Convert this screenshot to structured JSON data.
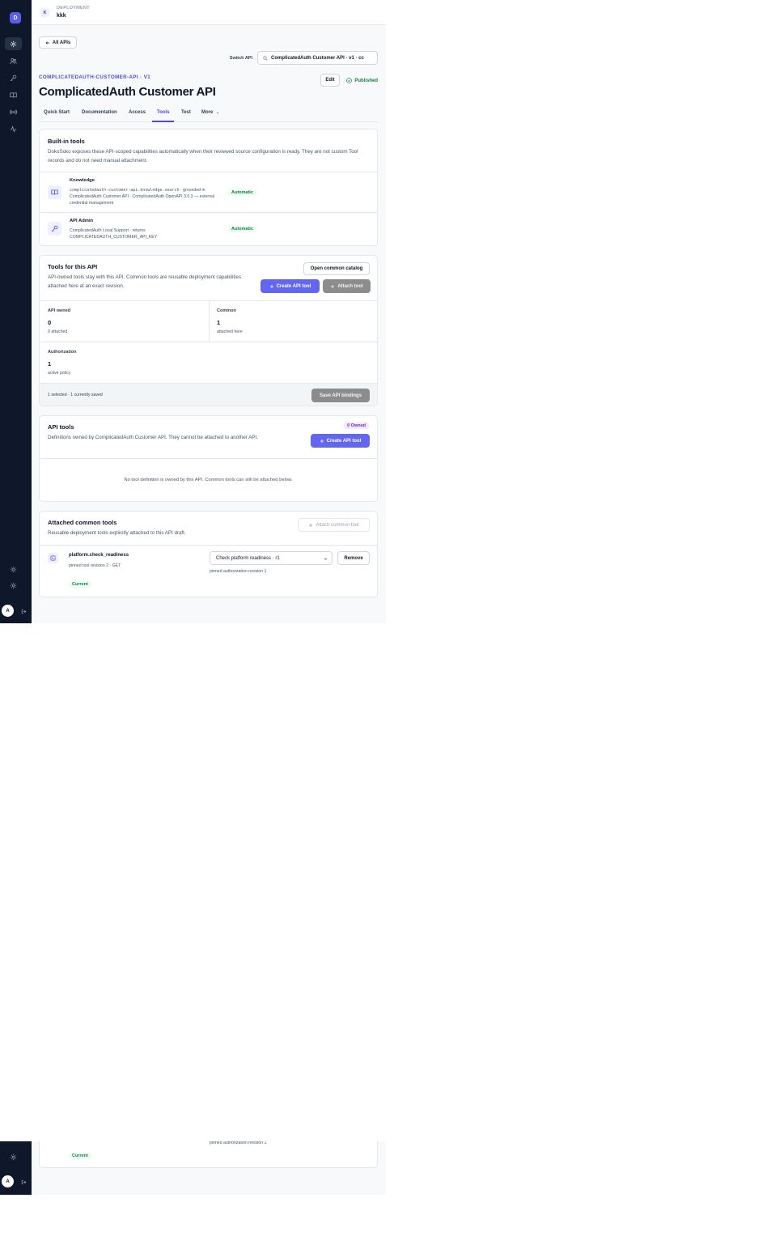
{
  "sidebar": {
    "brand": "D",
    "avatar": "A",
    "nav": [
      "api-icon",
      "users-icon",
      "key-icon",
      "book-icon",
      "broadcast-icon",
      "activity-icon"
    ],
    "bottom": [
      "sun-icon",
      "gear-icon"
    ]
  },
  "topbar": {
    "badge": "K",
    "label": "DEPLOYMENT",
    "name": "kkk"
  },
  "header": {
    "back": "All APIs",
    "switch_label": "Switch API",
    "switch_value": "ComplicatedAuth Customer API · v1 · cc",
    "slug": "COMPLICATEDAUTH-CUSTOMER-API · V1",
    "title": "ComplicatedAuth Customer API",
    "edit": "Edit",
    "status": "Published"
  },
  "tabs": [
    "Quick Start",
    "Documentation",
    "Access",
    "Tools",
    "Test",
    "More"
  ],
  "active_tab": "Tools",
  "builtin": {
    "title": "Built-in tools",
    "desc": "DokoSoko exposes these API-scoped capabilities automatically when their reviewed source configuration is ready. They are not custom Tool records and do not need manual attachment.",
    "items": [
      {
        "name": "Knowledge",
        "code": "complicatedauth-customer-api.knowledge.search",
        "desc": "· grounded in ComplicatedAuth Customer API · ComplicatedAuth OpenAPI 3.0.3 — external credential management",
        "badge": "Automatic"
      },
      {
        "name": "API Admin",
        "desc": "ComplicatedAuth Local Support · returns COMPLICATEDAUTH_CUSTOMER_API_KEY",
        "badge": "Automatic"
      }
    ]
  },
  "tools_for_api": {
    "title": "Tools for this API",
    "desc": "API-owned tools stay with this API. Common tools are reusable deployment capabilities attached here at an exact revision.",
    "open_catalog": "Open common catalog",
    "create": "Create API tool",
    "attach": "Attach tool",
    "stats": [
      {
        "label": "API owned",
        "value": "0",
        "sub": "0 attached"
      },
      {
        "label": "Common",
        "value": "1",
        "sub": "attached here"
      },
      {
        "label": "Authorization",
        "value": "1",
        "sub": "active policy"
      }
    ],
    "footer": "1 selected · 1 currently saved",
    "save": "Save API bindings"
  },
  "api_tools": {
    "title": "API tools",
    "badge": "0 Owned",
    "desc": "Definitions owned by ComplicatedAuth Customer API. They cannot be attached to another API.",
    "create": "Create API tool",
    "empty": "No tool definition is owned by this API. Common tools can still be attached below."
  },
  "common_tools": {
    "title": "Attached common tools",
    "desc": "Reusable deployment tools explicitly attached to this API draft.",
    "attach": "Attach common tool",
    "item": {
      "name": "platform.check_readiness",
      "sub": "pinned tool revision 2 · GET",
      "badge": "Current",
      "select": "Check platform readiness · r1",
      "pinned_auth": "pinned authorization revision 1",
      "remove": "Remove"
    }
  },
  "colors": {
    "sidebar": "#0f172a",
    "accent": "#6366f1",
    "success": "#15803d"
  }
}
